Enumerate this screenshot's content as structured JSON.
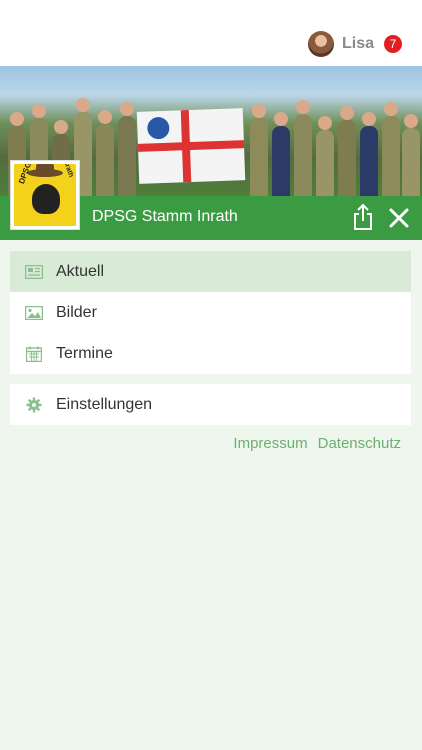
{
  "header": {
    "user_name": "Lisa",
    "notification_count": "7"
  },
  "group": {
    "title": "DPSG Stamm Inrath",
    "logo_left_text": "DPSG",
    "logo_right_text": "Inrath"
  },
  "menu": {
    "items": [
      {
        "label": "Aktuell",
        "icon": "newspaper-icon",
        "active": true
      },
      {
        "label": "Bilder",
        "icon": "image-icon",
        "active": false
      },
      {
        "label": "Termine",
        "icon": "calendar-icon",
        "active": false
      }
    ],
    "settings_label": "Einstellungen",
    "settings_icon": "gear-icon"
  },
  "footer": {
    "impressum": "Impressum",
    "datenschutz": "Datenschutz"
  },
  "colors": {
    "accent_green": "#3b9b43",
    "active_row": "#d9ead6",
    "link_green": "#6ab06e",
    "badge_red": "#e02020",
    "background": "#eff6ee"
  }
}
